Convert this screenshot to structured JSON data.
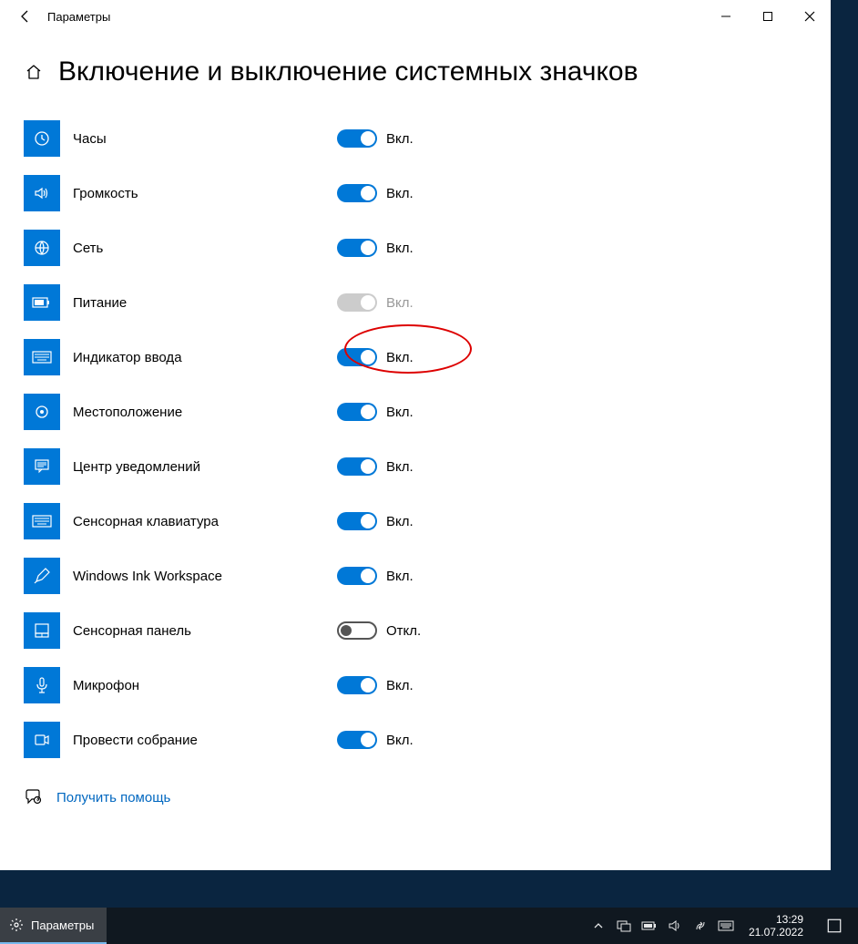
{
  "window": {
    "title": "Параметры",
    "back_icon": "←"
  },
  "page": {
    "title": "Включение и выключение системных значков"
  },
  "state_labels": {
    "on": "Вкл.",
    "off": "Откл."
  },
  "settings": [
    {
      "id": "clock",
      "label": "Часы",
      "state": "on",
      "disabled": false,
      "icon": "clock",
      "highlighted": false
    },
    {
      "id": "volume",
      "label": "Громкость",
      "state": "on",
      "disabled": false,
      "icon": "volume",
      "highlighted": false
    },
    {
      "id": "network",
      "label": "Сеть",
      "state": "on",
      "disabled": false,
      "icon": "globe",
      "highlighted": false
    },
    {
      "id": "power",
      "label": "Питание",
      "state": "on",
      "disabled": true,
      "icon": "battery",
      "highlighted": false
    },
    {
      "id": "input-indicator",
      "label": "Индикатор ввода",
      "state": "on",
      "disabled": false,
      "icon": "keyboard",
      "highlighted": true
    },
    {
      "id": "location",
      "label": "Местоположение",
      "state": "on",
      "disabled": false,
      "icon": "location",
      "highlighted": false
    },
    {
      "id": "action-center",
      "label": "Центр уведомлений",
      "state": "on",
      "disabled": false,
      "icon": "comment",
      "highlighted": false
    },
    {
      "id": "touch-keyboard",
      "label": "Сенсорная клавиатура",
      "state": "on",
      "disabled": false,
      "icon": "keyboard",
      "highlighted": false
    },
    {
      "id": "ink-workspace",
      "label": "Windows Ink Workspace",
      "state": "on",
      "disabled": false,
      "icon": "pen",
      "highlighted": false
    },
    {
      "id": "touchpad",
      "label": "Сенсорная панель",
      "state": "off",
      "disabled": false,
      "icon": "touchpad",
      "highlighted": false
    },
    {
      "id": "microphone",
      "label": "Микрофон",
      "state": "on",
      "disabled": false,
      "icon": "mic",
      "highlighted": false
    },
    {
      "id": "meet-now",
      "label": "Провести собрание",
      "state": "on",
      "disabled": false,
      "icon": "camera",
      "highlighted": false
    }
  ],
  "help": {
    "label": "Получить помощь"
  },
  "taskbar": {
    "app_label": "Параметры",
    "time": "13:29",
    "date": "21.07.2022"
  }
}
